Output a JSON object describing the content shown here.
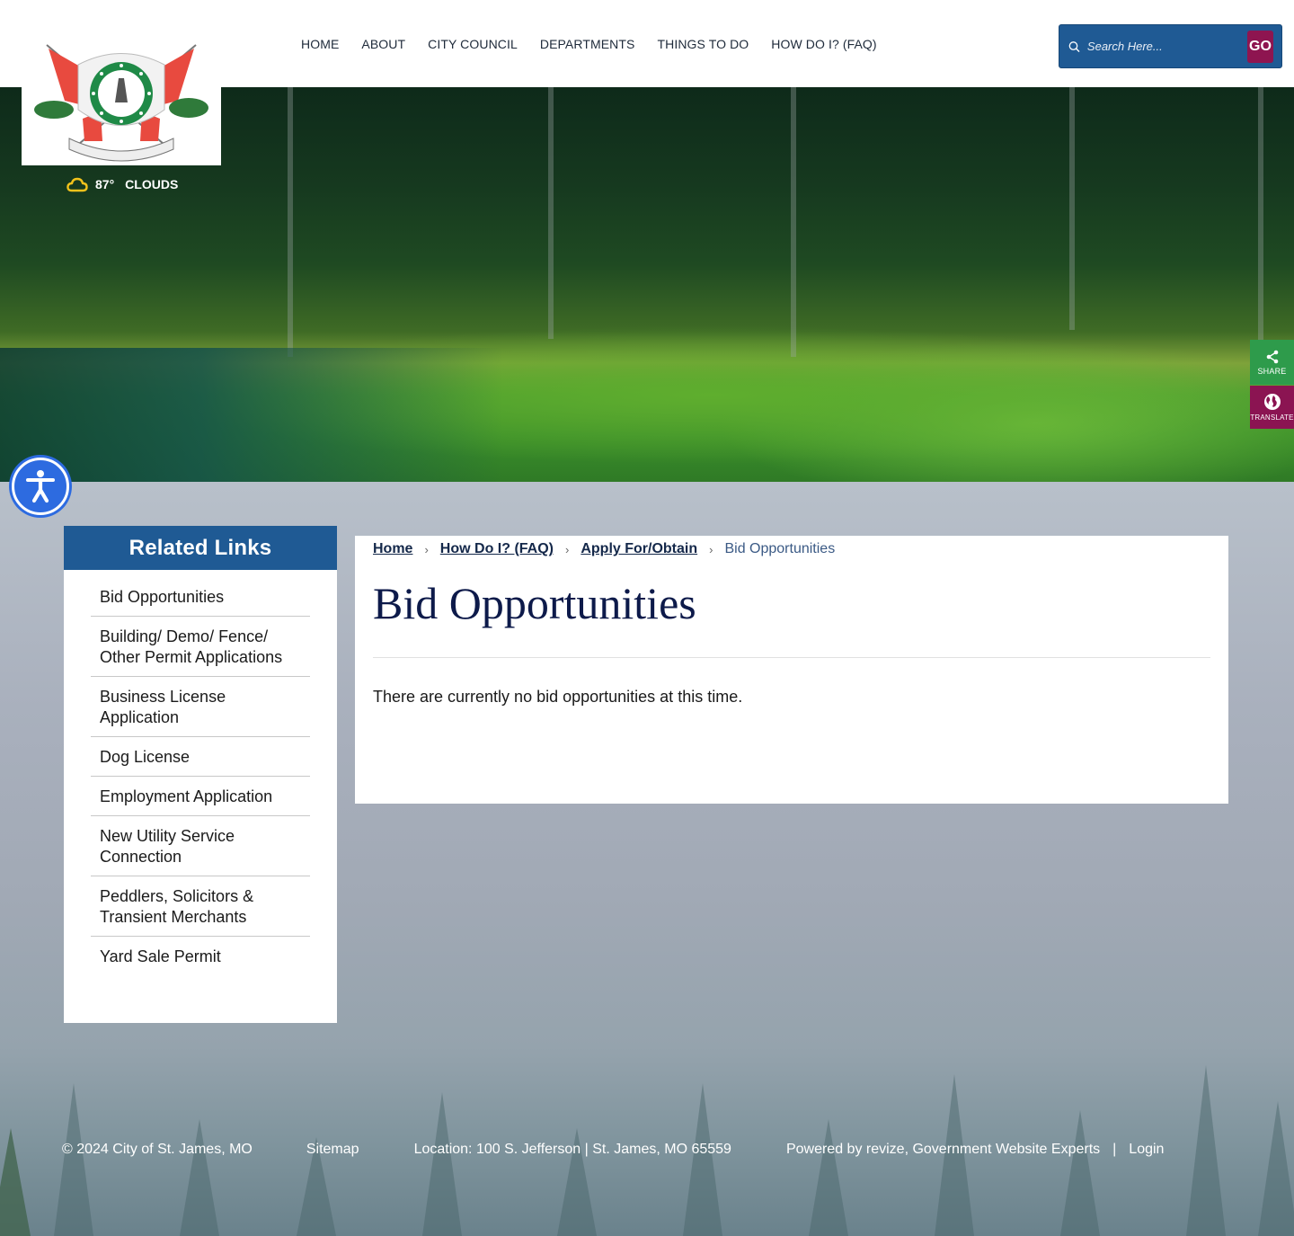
{
  "header": {
    "logo_alt": "City of St. James, Missouri seal",
    "nav": [
      {
        "label": "HOME"
      },
      {
        "label": "ABOUT"
      },
      {
        "label": "CITY COUNCIL"
      },
      {
        "label": "DEPARTMENTS"
      },
      {
        "label": "THINGS TO DO"
      },
      {
        "label": "HOW DO I? (FAQ)"
      }
    ],
    "search": {
      "placeholder": "Search Here...",
      "value": "",
      "go_label": "GO",
      "icon": "search-icon"
    }
  },
  "weather": {
    "temperature": "87°",
    "condition": "CLOUDS",
    "icon": "cloud-icon",
    "icon_color": "#f2c21b"
  },
  "side_tabs": {
    "share": {
      "label": "SHARE",
      "icon": "share-icon",
      "color": "#2e9b4b"
    },
    "translate": {
      "label": "TRANSLATE",
      "icon": "globe-icon",
      "color": "#8b1452"
    }
  },
  "accessibility": {
    "icon": "accessibility-icon",
    "color": "#2d6be0"
  },
  "sidebar": {
    "title": "Related Links",
    "items": [
      {
        "label": "Bid Opportunities"
      },
      {
        "label": "Building/ Demo/ Fence/ Other Permit Applications"
      },
      {
        "label": "Business License Application"
      },
      {
        "label": "Dog License"
      },
      {
        "label": "Employment Application"
      },
      {
        "label": "New Utility Service Connection"
      },
      {
        "label": "Peddlers, Solicitors & Transient Merchants"
      },
      {
        "label": "Yard Sale Permit"
      }
    ]
  },
  "breadcrumb": {
    "items": [
      {
        "label": "Home"
      },
      {
        "label": "How Do I? (FAQ)"
      },
      {
        "label": "Apply For/Obtain"
      }
    ],
    "separator": "›",
    "current": "Bid Opportunities"
  },
  "main": {
    "title": "Bid Opportunities",
    "body": "There are currently no bid opportunities at this time."
  },
  "footer": {
    "copyright": "© 2024 City of St. James, MO",
    "sitemap": "Sitemap",
    "location": "Location: 100 S. Jefferson | St. James, MO 65559",
    "powered_by": "Powered by revize, Government Website Experts",
    "divider": "|",
    "login": "Login"
  },
  "colors": {
    "brand_blue": "#1f5a94",
    "go_button": "#8e1550",
    "title_navy": "#0d1a4a"
  }
}
